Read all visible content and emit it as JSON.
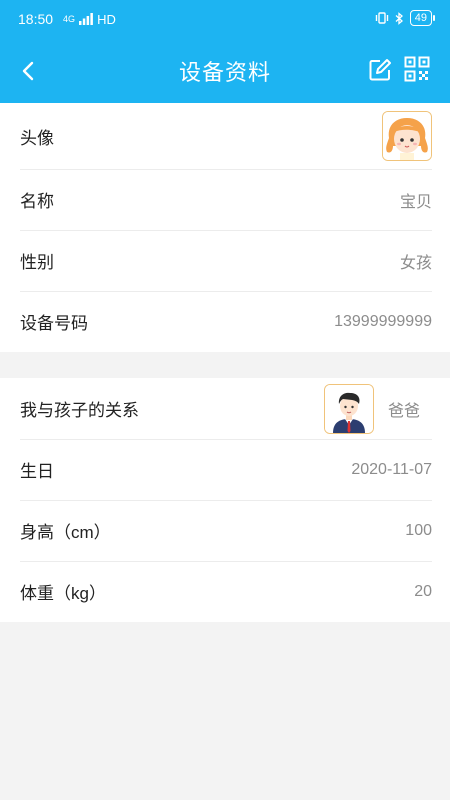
{
  "status_bar": {
    "time": "18:50",
    "network": "4G",
    "signal_label": "HD",
    "battery": "49"
  },
  "nav": {
    "title": "设备资料",
    "back_icon": "chevron-left-icon",
    "edit_icon": "edit-icon",
    "qr_icon": "qr-code-icon"
  },
  "device": {
    "rows": [
      {
        "label": "头像"
      },
      {
        "label": "名称",
        "value": "宝贝"
      },
      {
        "label": "性别",
        "value": "女孩"
      },
      {
        "label": "设备号码",
        "value": "13999999999"
      }
    ]
  },
  "child": {
    "rows": [
      {
        "label": "我与孩子的关系",
        "value": "爸爸"
      },
      {
        "label": "生日",
        "value": "2020-11-07"
      },
      {
        "label": "身高（cm）",
        "value": "100"
      },
      {
        "label": "体重（kg）",
        "value": "20"
      }
    ]
  },
  "colors": {
    "header": "#1db4f2",
    "background": "#f3f3f3",
    "value_text": "#8c8c8c"
  }
}
